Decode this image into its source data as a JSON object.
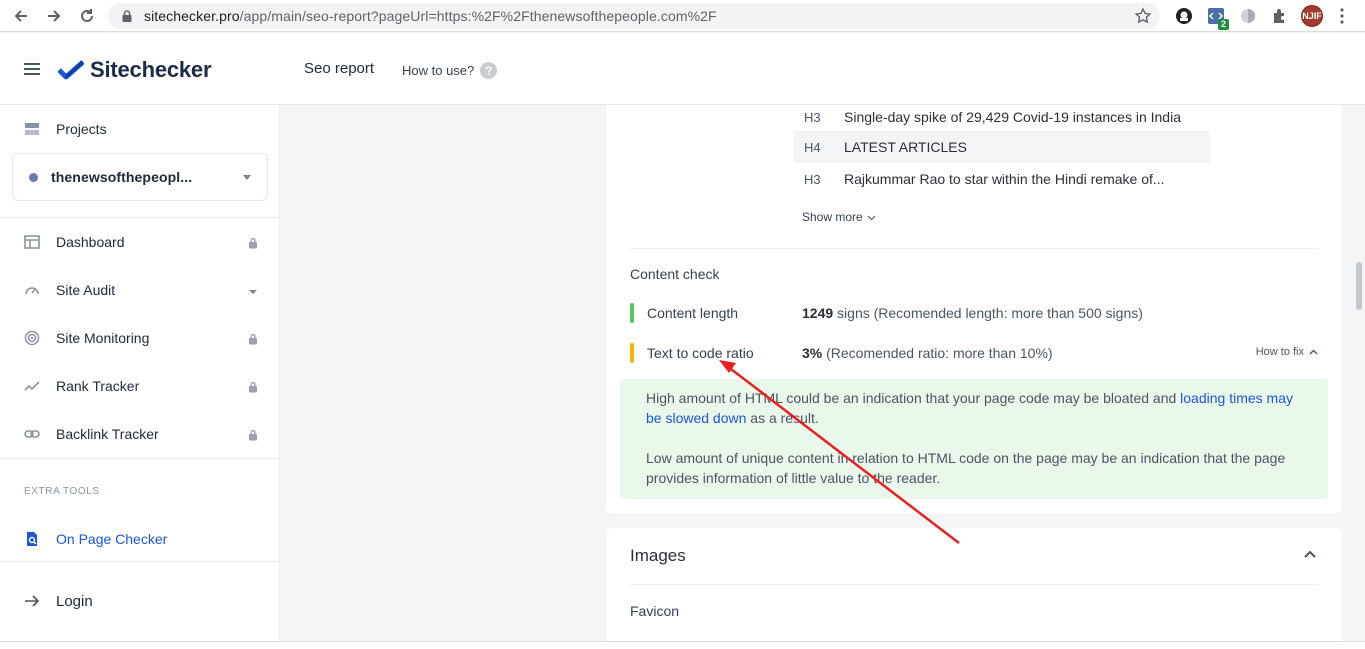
{
  "browser": {
    "url_host": "sitechecker.pro",
    "url_path": "/app/main/seo-report?pageUrl=https:%2F%2Fthenewsofthepeople.com%2F",
    "extension_badge": "2",
    "profile_initials": "NJIF"
  },
  "header": {
    "logo": "Sitechecker",
    "page_title": "Seo report",
    "how_to_use": "How to use?",
    "help_glyph": "?"
  },
  "sidebar": {
    "projects_label": "Projects",
    "project_name": "thenewsofthepeopl...",
    "items": [
      {
        "label": "Dashboard",
        "icon": "dashboard-icon",
        "locked": true
      },
      {
        "label": "Site Audit",
        "icon": "gauge-icon",
        "dropdown": true
      },
      {
        "label": "Site Monitoring",
        "icon": "radar-icon",
        "locked": true
      },
      {
        "label": "Rank Tracker",
        "icon": "trend-icon",
        "locked": true
      },
      {
        "label": "Backlink Tracker",
        "icon": "link-icon",
        "locked": true
      }
    ],
    "extra_tools_label": "EXTRA TOOLS",
    "on_page_checker": "On Page Checker",
    "login": "Login"
  },
  "headings": [
    {
      "tag": "H3",
      "text": "Single-day spike of 29,429 Covid-19 instances in India"
    },
    {
      "tag": "H4",
      "text": "LATEST ARTICLES"
    },
    {
      "tag": "H3",
      "text": "Rajkummar Rao to star within the Hindi remake of..."
    }
  ],
  "show_more": "Show more",
  "content_check": {
    "title": "Content check",
    "rows": [
      {
        "label": "Content length",
        "value_bold": "1249",
        "value_rest": " signs (Recomended length: more than 500 signs)",
        "status_color": "#4cc95a"
      },
      {
        "label": "Text to code ratio",
        "value_bold": "3%",
        "value_rest": " (Recomended ratio: more than 10%)",
        "status_color": "#f5b400"
      }
    ],
    "how_to_fix": "How to fix",
    "fix_p1_before": "High amount of HTML could be an indication that your page code may be bloated and ",
    "fix_p1_link": "loading times may be slowed down",
    "fix_p1_after": " as a result.",
    "fix_p2": "Low amount of unique content in relation to HTML code on the page may be an indication that the page provides information of little value to the reader."
  },
  "images_section": {
    "title": "Images",
    "favicon": "Favicon"
  },
  "colors": {
    "accent": "#1a56db",
    "arrow": "#e8201f",
    "fix_bg": "#eaf8ec"
  }
}
